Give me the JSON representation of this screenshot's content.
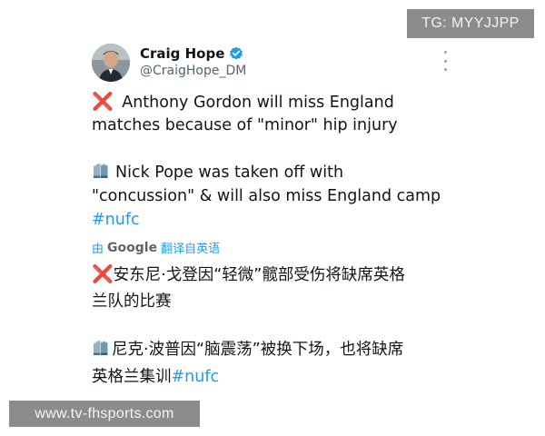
{
  "watermarks": {
    "top": "TG: MYYJJPP",
    "bottom": "www.tv-fhsports.com"
  },
  "author": {
    "display_name": "Craig Hope",
    "handle": "@CraigHope_DM",
    "verified": true,
    "verified_color": "#1d9bf0"
  },
  "icons": {
    "more": "more-options-icon",
    "cross": "cross-mark-emoji",
    "glove": "gloves-emoji"
  },
  "tweet": {
    "line1_emoji": "❌",
    "line1_text": " Anthony Gordon will miss England",
    "line2_text": "matches because of \"minor\" hip injury",
    "line3_text": "Nick Pope was taken off with",
    "line4_text": "\"concussion\" & will also miss England camp",
    "hashtag": "#nufc"
  },
  "translation": {
    "by_label": "由",
    "google_label": "Google",
    "action_label": "翻译自英语",
    "line1_emoji": "❌",
    "line1_text": "安东尼·戈登因“轻微”髋部受伤将缺席英格",
    "line2_text": "兰队的比赛",
    "line3_text": "尼克·波普因“脑震荡”被换下场，也将缺席",
    "line4_text": "英格兰集训",
    "hashtag": "#nufc"
  },
  "colors": {
    "text_primary": "#0f1419",
    "text_secondary": "#536471",
    "link": "#1d9bf0",
    "cross_red": "#e0284b"
  }
}
